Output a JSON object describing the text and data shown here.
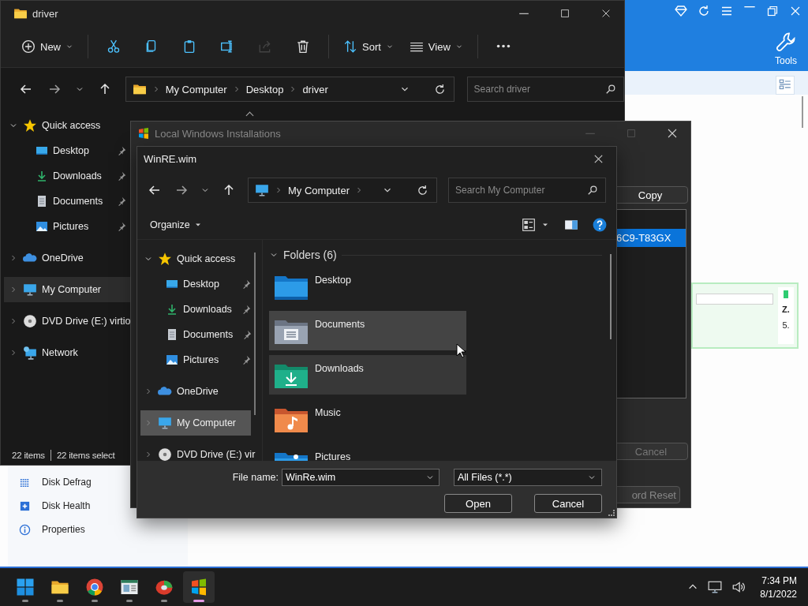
{
  "background_app": {
    "tools_label": "Tools",
    "sidebar_items": [
      {
        "kind": "defrag",
        "label": "Disk Defrag"
      },
      {
        "kind": "health",
        "label": "Disk Health"
      },
      {
        "kind": "info",
        "label": "Properties"
      }
    ],
    "panel_texts": [
      "Z.",
      "5."
    ]
  },
  "explorer": {
    "title": "driver",
    "toolbar": [
      {
        "kind": "new",
        "label": "New",
        "disabled": false
      },
      {
        "kind": "cut",
        "disabled": false
      },
      {
        "kind": "copy",
        "disabled": false
      },
      {
        "kind": "paste",
        "disabled": false
      },
      {
        "kind": "rename",
        "disabled": false
      },
      {
        "kind": "share",
        "disabled": true
      },
      {
        "kind": "delete",
        "disabled": false
      },
      {
        "kind": "sort",
        "label": "Sort",
        "disabled": false
      },
      {
        "kind": "view",
        "label": "View",
        "disabled": false
      },
      {
        "kind": "more",
        "disabled": false
      }
    ],
    "breadcrumb": [
      "My Computer",
      "Desktop",
      "driver"
    ],
    "search_placeholder": "Search driver",
    "nav": [
      {
        "label": "Quick access",
        "kind": "star",
        "expanded": true,
        "selected": false,
        "children": [
          {
            "label": "Desktop",
            "kind": "desktop",
            "pinned": true
          },
          {
            "label": "Downloads",
            "kind": "download",
            "pinned": true
          },
          {
            "label": "Documents",
            "kind": "document",
            "pinned": true
          },
          {
            "label": "Pictures",
            "kind": "picture",
            "pinned": true
          }
        ]
      },
      {
        "label": "OneDrive",
        "kind": "cloud",
        "expanded": false,
        "selected": false
      },
      {
        "label": "My Computer",
        "kind": "computer",
        "expanded": false,
        "selected": true
      },
      {
        "label": "DVD Drive (E:) virtio",
        "kind": "disc",
        "expanded": false,
        "selected": false
      },
      {
        "label": "Network",
        "kind": "network",
        "expanded": false,
        "selected": false
      }
    ],
    "status": [
      "22 items",
      "22 items select"
    ]
  },
  "installations": {
    "title": "Local Windows Installations",
    "copy_button": "Copy",
    "rows": [
      {
        "text": "6C9-T83GX",
        "selected": true
      }
    ],
    "cancel_button": "Cancel",
    "reset_button": "ord Reset"
  },
  "dialog": {
    "title": "WinRE.wim",
    "breadcrumb": [
      "My Computer"
    ],
    "search_placeholder": "Search My Computer",
    "organize": "Organize",
    "nav": [
      {
        "label": "Quick access",
        "kind": "star",
        "expanded": true,
        "selected": false,
        "children": [
          {
            "label": "Desktop",
            "kind": "desktop",
            "pinned": true
          },
          {
            "label": "Downloads",
            "kind": "download",
            "pinned": true
          },
          {
            "label": "Documents",
            "kind": "document",
            "pinned": true
          },
          {
            "label": "Pictures",
            "kind": "picture",
            "pinned": true
          }
        ]
      },
      {
        "label": "OneDrive",
        "kind": "cloud",
        "expanded": false,
        "selected": false
      },
      {
        "label": "My Computer",
        "kind": "computer",
        "expanded": false,
        "selected": true
      },
      {
        "label": "DVD Drive (E:) vir",
        "kind": "disc",
        "expanded": false,
        "selected": false
      }
    ],
    "group_label": "Folders (6)",
    "folders": [
      {
        "label": "Desktop",
        "kind": "desktop",
        "hovered": false,
        "selected": false
      },
      {
        "label": "Documents",
        "kind": "documents",
        "hovered": true,
        "selected": false
      },
      {
        "label": "Downloads",
        "kind": "downloads",
        "hovered": false,
        "selected": true
      },
      {
        "label": "Music",
        "kind": "music",
        "hovered": false,
        "selected": false
      },
      {
        "label": "Pictures",
        "kind": "pictures",
        "hovered": false,
        "selected": false
      }
    ],
    "file_name_label": "File name:",
    "file_name": "WinRe.wim",
    "file_type": "All Files (*.*)",
    "open_button": "Open",
    "cancel_button": "Cancel"
  },
  "taskbar": {
    "apps": [
      {
        "kind": "start",
        "active": false
      },
      {
        "kind": "explorer",
        "active": false
      },
      {
        "kind": "chrome",
        "active": false
      },
      {
        "kind": "window",
        "active": false
      },
      {
        "kind": "disk",
        "active": false
      },
      {
        "kind": "flag",
        "active": true
      }
    ],
    "time": "7:34 PM",
    "date": "8/1/2022"
  }
}
